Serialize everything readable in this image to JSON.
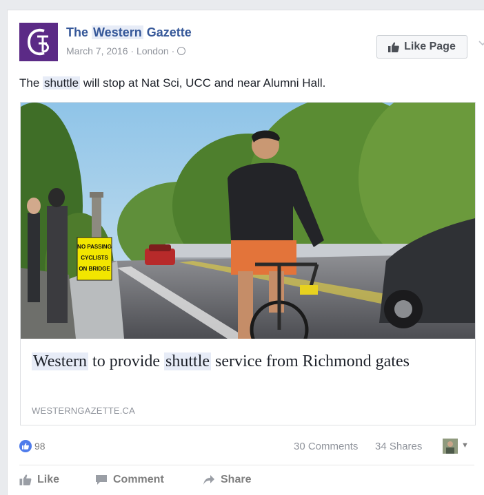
{
  "post": {
    "page_name_pre": "The ",
    "page_name_hl": "Western",
    "page_name_post": " Gazette",
    "date": "March 7, 2016",
    "location": "London",
    "separator": "·",
    "text_pre": "The ",
    "text_hl": "shuttle",
    "text_post": " will stop at Nat Sci, UCC and near Alumni Hall."
  },
  "buttons": {
    "like_page": "Like Page"
  },
  "link": {
    "title_hl1": "Western",
    "title_mid": " to provide ",
    "title_hl2": "shuttle",
    "title_post": " service from Richmond gates",
    "domain": "WESTERNGAZETTE.CA",
    "sign_lines": [
      "NO PASSING",
      "CYCLISTS",
      "ON BRIDGE"
    ]
  },
  "stats": {
    "likes": "98",
    "comments": "30 Comments",
    "shares": "34 Shares"
  },
  "actions": {
    "like": "Like",
    "comment": "Comment",
    "share": "Share"
  },
  "icons": {
    "like_badge": "like-icon",
    "globe": "globe-icon",
    "chevron": "chevron-down-icon"
  },
  "colors": {
    "link_blue": "#365899",
    "logo_purple": "#5b2a86",
    "like_blue": "#4f7ceb",
    "highlight": "#e7ecf7"
  }
}
